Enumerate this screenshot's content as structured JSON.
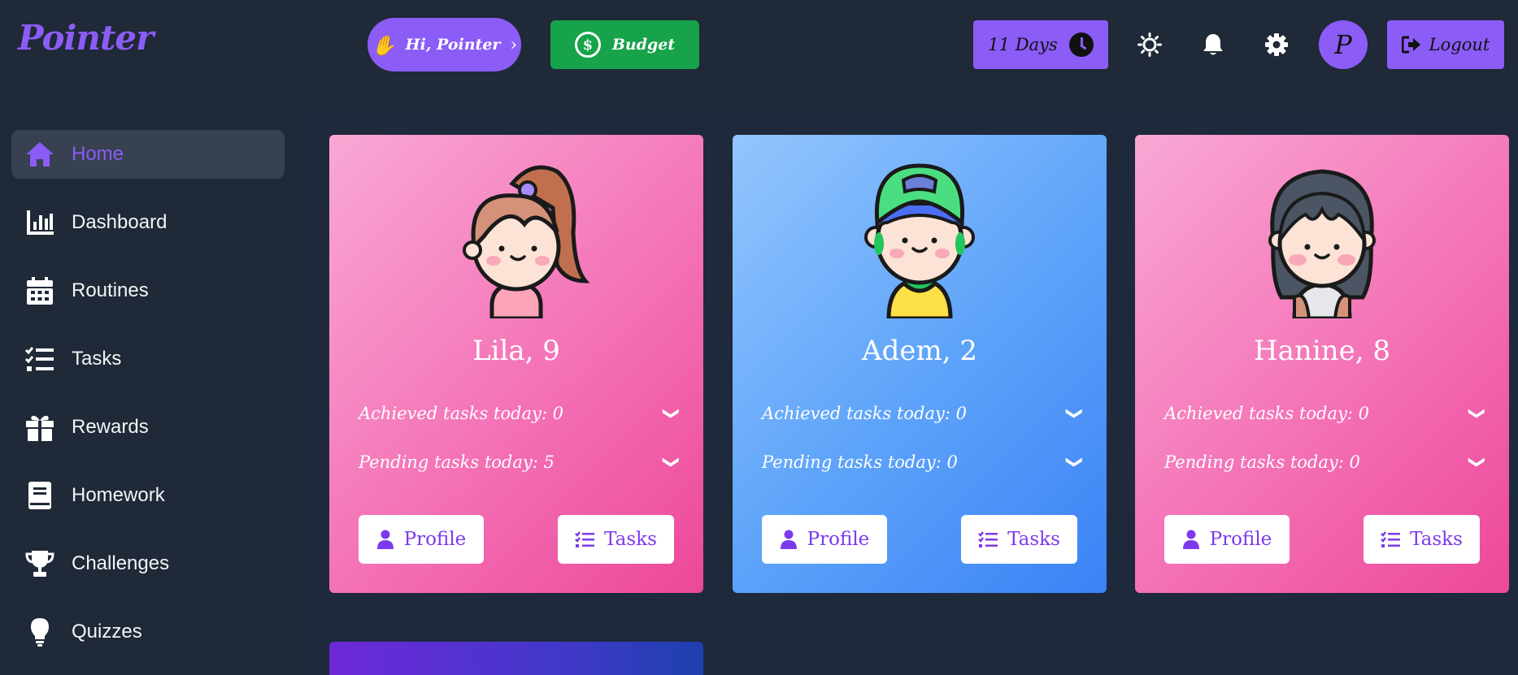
{
  "header": {
    "logo": "Pointer",
    "greeting": "Hi, Pointer",
    "budget_label": "Budget",
    "days_label": "11 Days",
    "avatar_letter": "P",
    "logout_label": "Logout"
  },
  "sidebar": {
    "items": [
      {
        "label": "Home",
        "icon": "home-icon",
        "active": true
      },
      {
        "label": "Dashboard",
        "icon": "bar-chart-icon"
      },
      {
        "label": "Routines",
        "icon": "calendar-icon"
      },
      {
        "label": "Tasks",
        "icon": "checklist-icon"
      },
      {
        "label": "Rewards",
        "icon": "gift-icon"
      },
      {
        "label": "Homework",
        "icon": "book-icon"
      },
      {
        "label": "Challenges",
        "icon": "trophy-icon"
      },
      {
        "label": "Quizzes",
        "icon": "lightbulb-icon"
      }
    ]
  },
  "kids": [
    {
      "name": "Lila, 9",
      "achieved": "Achieved tasks today: 0",
      "pending": "Pending tasks today: 5",
      "profile_label": "Profile",
      "tasks_label": "Tasks",
      "theme": "pink"
    },
    {
      "name": "Adem, 2",
      "achieved": "Achieved tasks today: 0",
      "pending": "Pending tasks today: 0",
      "profile_label": "Profile",
      "tasks_label": "Tasks",
      "theme": "blue"
    },
    {
      "name": "Hanine, 8",
      "achieved": "Achieved tasks today: 0",
      "pending": "Pending tasks today: 0",
      "profile_label": "Profile",
      "tasks_label": "Tasks",
      "theme": "pink"
    }
  ],
  "colors": {
    "accent": "#8b5cf6",
    "budget": "#16a34a",
    "background": "#1f2937"
  }
}
